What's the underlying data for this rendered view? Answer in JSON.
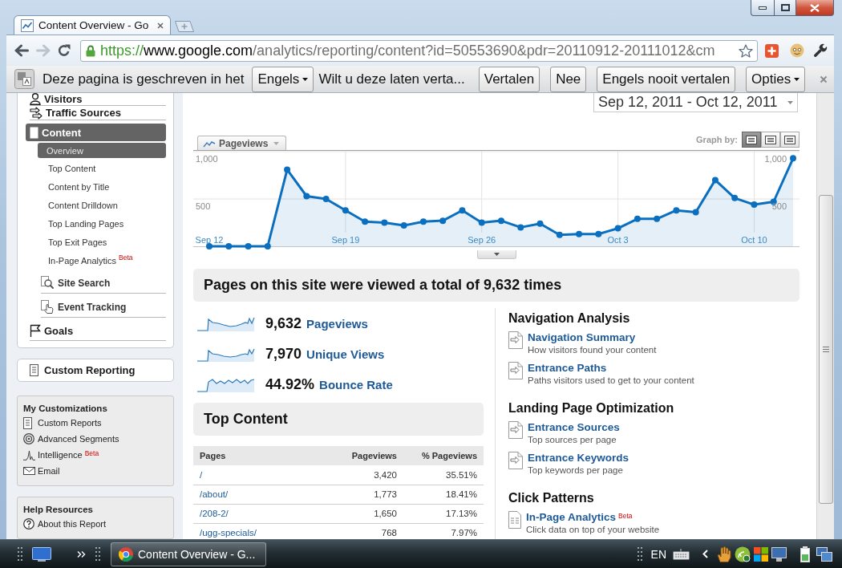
{
  "browser": {
    "tab_title": "Content Overview - Go",
    "nav_buttons": [
      {
        "kind": "back",
        "disabled": false
      },
      {
        "kind": "forward",
        "disabled": true
      },
      {
        "kind": "reload",
        "disabled": false
      }
    ],
    "url": {
      "scheme": "https://",
      "host": "www.google.com",
      "path": "/analytics/reporting/content?id=50553690&pdr=20110912-20111012&cm"
    }
  },
  "translate_bar": {
    "message": "Deze pagina is geschreven in het",
    "language": "Engels",
    "question": "Wilt u deze laten verta...",
    "buttons": [
      "Vertalen",
      "Nee",
      "Engels nooit vertalen"
    ],
    "options": "Opties"
  },
  "sidebar": {
    "nav": [
      {
        "label": "Visitors",
        "selected": false
      },
      {
        "label": "Traffic Sources",
        "selected": false
      },
      {
        "label": "Content",
        "selected": true,
        "children": [
          {
            "kind": "page",
            "label": "Overview",
            "selected": true
          },
          {
            "kind": "page",
            "label": "Top Content",
            "selected": false
          },
          {
            "kind": "page",
            "label": "Content by Title",
            "selected": false
          },
          {
            "kind": "page",
            "label": "Content Drilldown",
            "selected": false
          },
          {
            "kind": "page",
            "label": "Top Landing Pages",
            "selected": false
          },
          {
            "kind": "page",
            "label": "Top Exit Pages",
            "selected": false
          },
          {
            "kind": "page",
            "label": "In-Page Analytics",
            "badge": "Beta",
            "selected": false
          },
          {
            "kind": "section",
            "label": "Site Search",
            "selected": false
          },
          {
            "kind": "section",
            "label": "Event Tracking",
            "selected": false
          }
        ]
      },
      {
        "label": "Goals",
        "selected": false
      }
    ],
    "custom_reporting": "Custom Reporting",
    "customizations": {
      "title": "My Customizations",
      "items": [
        {
          "label": "Custom Reports"
        },
        {
          "label": "Advanced Segments"
        },
        {
          "label": "Intelligence",
          "badge": "Beta"
        },
        {
          "label": "Email"
        }
      ]
    },
    "help": {
      "title": "Help Resources",
      "items": [
        {
          "label": "About this Report"
        }
      ]
    }
  },
  "report": {
    "date_range": "Sep 12, 2011 - Oct 12, 2011",
    "graph": {
      "graph_by_label": "Graph by:",
      "graph_by": [
        {
          "selected": true
        },
        {
          "selected": false
        },
        {
          "selected": false
        }
      ],
      "chart_data": {
        "type": "area",
        "grid": true,
        "categories": [
          "Sep 12",
          null,
          null,
          null,
          null,
          null,
          null,
          "Sep 19",
          null,
          null,
          null,
          null,
          null,
          null,
          "Sep 26",
          null,
          null,
          null,
          null,
          null,
          null,
          "Oct 3",
          null,
          null,
          null,
          null,
          null,
          null,
          "Oct 10",
          null,
          null
        ],
        "ylim": [
          0,
          1000
        ],
        "yticks": [
          {
            "value": 500,
            "label": "500"
          },
          {
            "value": 1000,
            "label": "1,000"
          }
        ],
        "series": [
          {
            "name": "Pageviews",
            "color": "#0b6fc0",
            "values": [
              0,
              0,
              0,
              0,
              810,
              530,
              500,
              380,
              260,
              250,
              220,
              260,
              270,
              380,
              250,
              270,
              200,
              240,
              120,
              130,
              130,
              190,
              290,
              290,
              380,
              360,
              700,
              510,
              440,
              470,
              930
            ]
          }
        ]
      }
    },
    "summary": "Pages on this site were viewed a total of 9,632 times",
    "metrics": [
      {
        "value": "9,632",
        "label": "Pageviews"
      },
      {
        "value": "7,970",
        "label": "Unique Views"
      },
      {
        "value": "44.92%",
        "label": "Bounce Rate"
      }
    ],
    "top_content": {
      "title": "Top Content",
      "columns": [
        "Pages",
        "Pageviews",
        "% Pageviews"
      ],
      "rows": [
        [
          "/",
          "3,420",
          "35.51%"
        ],
        [
          "/about/",
          "1,773",
          "18.41%"
        ],
        [
          "/208-2/",
          "1,650",
          "17.13%"
        ],
        [
          "/ugg-specials/",
          "768",
          "7.97%"
        ]
      ]
    },
    "sections": [
      {
        "title": "Navigation Analysis",
        "items": [
          {
            "label": "Navigation Summary",
            "description": "How visitors found your content"
          },
          {
            "label": "Entrance Paths",
            "description": "Paths visitors used to get to your content"
          }
        ]
      },
      {
        "title": "Landing Page Optimization",
        "items": [
          {
            "label": "Entrance Sources",
            "description": "Top sources per page"
          },
          {
            "label": "Entrance Keywords",
            "description": "Top keywords per page"
          }
        ]
      },
      {
        "title": "Click Patterns",
        "items": [
          {
            "label": "In-Page Analytics",
            "badge": "Beta",
            "description": "Click data on top of your website"
          }
        ]
      }
    ]
  },
  "taskbar": {
    "windows": [
      {
        "title": "Content Overview - G...",
        "selected": true
      }
    ],
    "language": "EN"
  }
}
